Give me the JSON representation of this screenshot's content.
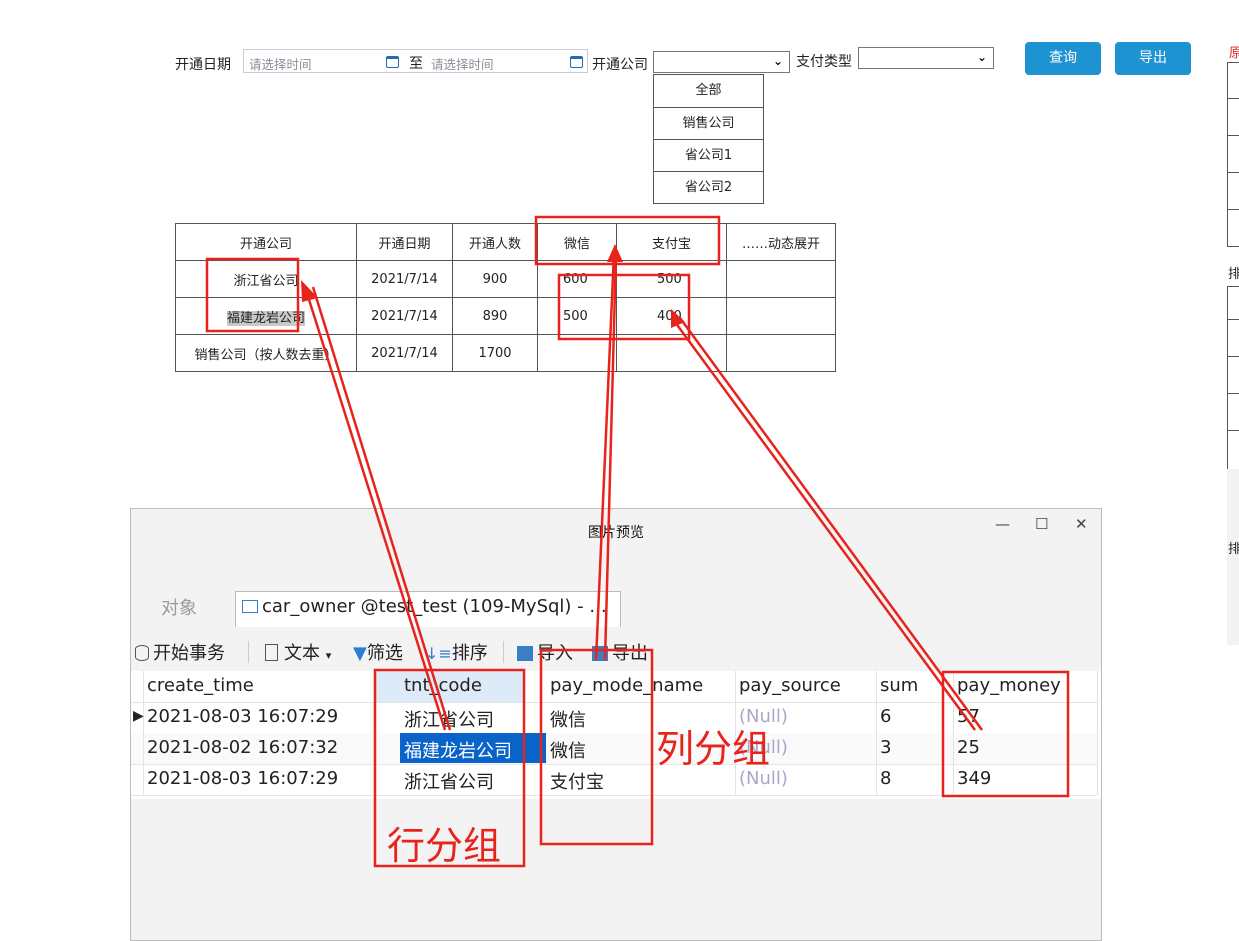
{
  "filter": {
    "open_date_label": "开通日期",
    "start_placeholder": "请选择时间",
    "to_label": "至",
    "end_placeholder": "请选择时间",
    "company_label": "开通公司",
    "pay_type_label": "支付类型",
    "query_button": "查询",
    "export_button": "导出"
  },
  "company_options": [
    "全部",
    "销售公司",
    "省公司1",
    "省公司2"
  ],
  "report": {
    "headers": [
      "开通公司",
      "开通日期",
      "开通人数",
      "微信",
      "支付宝",
      "……动态展开"
    ],
    "rows": [
      [
        "浙江省公司",
        "2021/7/14",
        "900",
        "600",
        "500",
        ""
      ],
      [
        "福建龙岩公司",
        "2021/7/14",
        "890",
        "500",
        "400",
        ""
      ],
      [
        "销售公司（按人数去重）",
        "2021/7/14",
        "1700",
        "",
        "",
        ""
      ]
    ]
  },
  "right_edge": {
    "top_char": "原",
    "mid_char": "排",
    "low_char": "排"
  },
  "preview": {
    "title": "图片预览",
    "controls": {
      "minimize": "—",
      "maximize": "☐",
      "close": "✕"
    },
    "tab_objects": "对象",
    "tab_table": "car_owner @test_test (109-MySql) - ...",
    "toolbar": {
      "begin_tx": "开始事务",
      "text": "文本",
      "filter": "筛选",
      "sort": "排序",
      "import": "导入",
      "export": "导出"
    },
    "columns": [
      "create_time",
      "tnt_code",
      "pay_mode_name",
      "pay_source",
      "sum",
      "pay_money"
    ],
    "rows": [
      [
        "2021-08-03 16:07:29",
        "浙江省公司",
        "微信",
        "(Null)",
        "6",
        "57"
      ],
      [
        "2021-08-02 16:07:32",
        "福建龙岩公司",
        "微信",
        "(Null)",
        "3",
        "25"
      ],
      [
        "2021-08-03 16:07:29",
        "浙江省公司",
        "支付宝",
        "(Null)",
        "8",
        "349"
      ]
    ]
  },
  "annotations": {
    "row_group": "行分组",
    "col_group": "列分组"
  },
  "colors": {
    "accent": "#1d93d1",
    "annotation": "#e8231c",
    "selection": "#0a63c8"
  }
}
